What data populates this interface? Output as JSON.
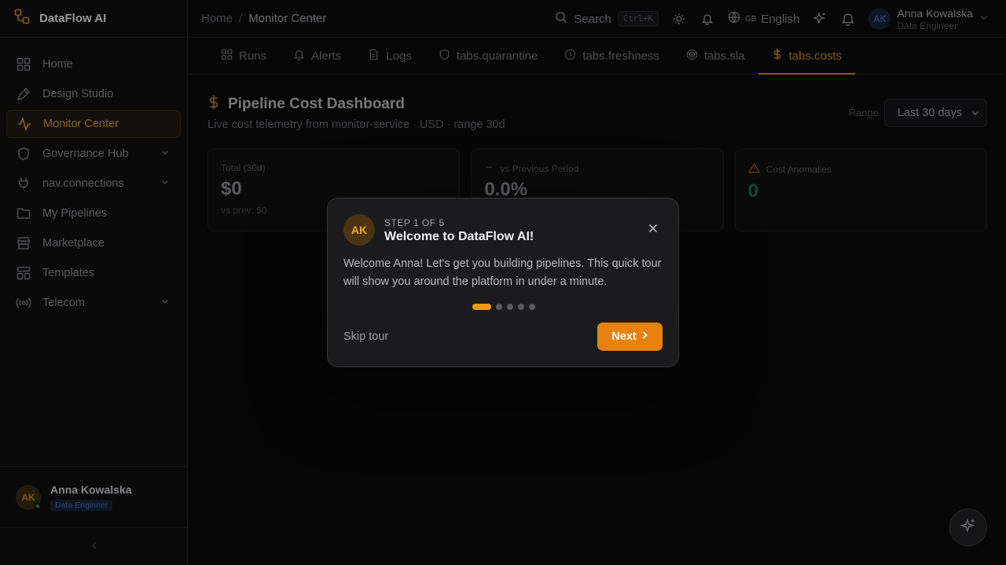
{
  "brand": {
    "name": "DataFlow AI"
  },
  "sidebar": {
    "items": [
      {
        "label": "Home",
        "icon": "grid-icon"
      },
      {
        "label": "Design Studio",
        "icon": "pen-icon"
      },
      {
        "label": "Monitor Center",
        "icon": "activity-icon",
        "active": true
      },
      {
        "label": "Governance Hub",
        "icon": "shield-icon",
        "expandable": true
      },
      {
        "label": "nav.connections",
        "icon": "plug-icon",
        "expandable": true
      },
      {
        "label": "My Pipelines",
        "icon": "folder-icon"
      },
      {
        "label": "Marketplace",
        "icon": "store-icon"
      },
      {
        "label": "Templates",
        "icon": "templates-icon"
      },
      {
        "label": "Telecom",
        "icon": "radio-icon",
        "expandable": true
      }
    ],
    "footer": {
      "initials": "AK",
      "name": "Anna Kowalska",
      "role": "Data Engineer"
    }
  },
  "topbar": {
    "breadcrumb": [
      "Home",
      "Monitor Center"
    ],
    "search_label": "Search",
    "search_shortcut": "Ctrl+K",
    "lang_flag": "GB",
    "language": "English",
    "user": {
      "initials": "AK",
      "name": "Anna Kowalska",
      "role": "Data Engineer"
    }
  },
  "tabs": [
    {
      "label": "Runs",
      "icon": "grid-icon"
    },
    {
      "label": "Alerts",
      "icon": "bell-icon"
    },
    {
      "label": "Logs",
      "icon": "file-icon"
    },
    {
      "label": "tabs.quarantine",
      "icon": "shield-icon"
    },
    {
      "label": "tabs.freshness",
      "icon": "clock-icon"
    },
    {
      "label": "tabs.sla",
      "icon": "target-icon"
    },
    {
      "label": "tabs.costs",
      "icon": "dollar-icon",
      "active": true
    }
  ],
  "page": {
    "title": "Pipeline Cost Dashboard",
    "subtitle": "Live cost telemetry from monitor-service · USD · range 30d",
    "range_label": "Range",
    "range_value": "Last 30 days",
    "cards": [
      {
        "label": "Total (30d)",
        "value": "$0",
        "foot": "vs prev: $0"
      },
      {
        "label": "vs Previous Period",
        "value": "0.0%",
        "foot": ""
      },
      {
        "label": "Cost Anomalies",
        "value": "0",
        "foot": ""
      }
    ]
  },
  "tour": {
    "initials": "AK",
    "step": "STEP 1 OF 5",
    "title": "Welcome to DataFlow AI!",
    "body": "Welcome Anna! Let's get you building pipelines. This quick tour will show you around the platform in under a minute.",
    "total_steps": 5,
    "current_step": 1,
    "skip_label": "Skip tour",
    "next_label": "Next"
  },
  "colors": {
    "accent": "#e8820f",
    "active_nav": "#d99a2b"
  }
}
